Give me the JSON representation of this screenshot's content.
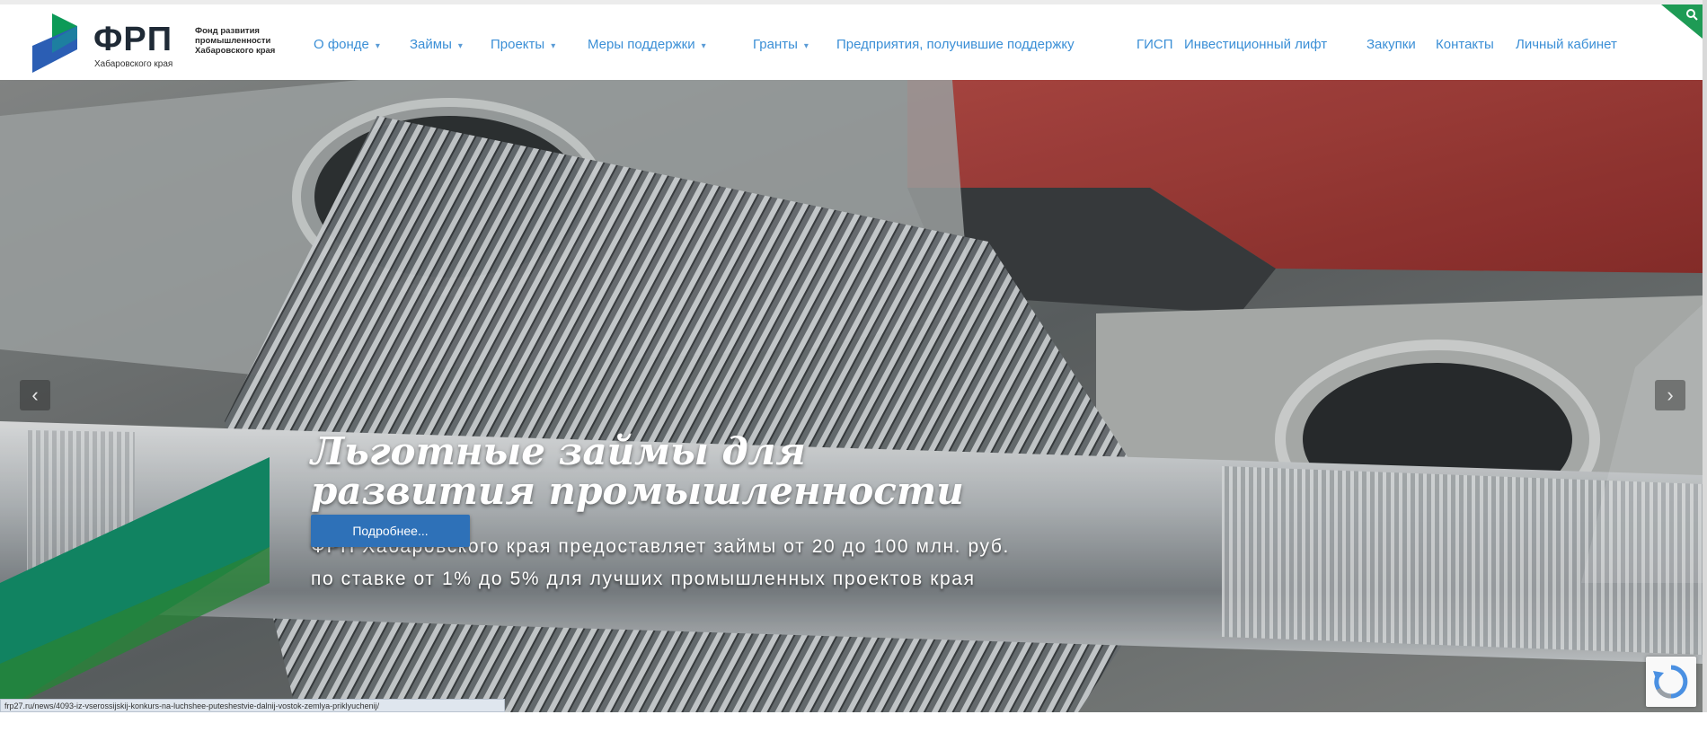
{
  "logo": {
    "abbr": "ФРП",
    "subtitle_lines": [
      "Фонд развития",
      "промышленности",
      "Хабаровского края"
    ],
    "city": "Хабаровского края",
    "colors": {
      "dark": "#1f2a36",
      "green": "#0c9a57",
      "blue": "#2b5eb4"
    }
  },
  "nav": {
    "items": [
      {
        "label": "О фонде",
        "caret": "▾"
      },
      {
        "label": "Займы",
        "caret": "▾"
      },
      {
        "label": "Проекты",
        "caret": "▾"
      },
      {
        "label": "Меры поддержки",
        "caret": "▾"
      },
      {
        "label": "Гранты",
        "caret": "▾"
      },
      {
        "label": "Предприятия, получившие поддержку"
      },
      {
        "label": "ГИСП"
      },
      {
        "label": "Инвестиционный лифт"
      },
      {
        "label": "Закупки"
      },
      {
        "label": "Контакты"
      },
      {
        "label": "Личный кабинет"
      }
    ],
    "link_color": "#3b8fd6"
  },
  "hero": {
    "title": "Льготные займы для развития промышленности",
    "description_line1": "ФРП Хабаровского края предоставляет займы от 20 до 100 млн. руб.",
    "description_line2": "по ставке от 1% до 5% для лучших промышленных проектов края",
    "button_label": "Подробнее...",
    "button_color": "#2e71b8",
    "accent_green": "#138f6a",
    "prev_arrow": "‹",
    "next_arrow": "›"
  },
  "status_bar": {
    "url": "frp27.ru/news/4093-iz-vserossijskij-konkurs-na-luchshee-puteshestvie-dalnij-vostok-zemlya-priklyuchenij/"
  },
  "icons": {
    "corner": "search-icon",
    "recaptcha": "recaptcha-icon"
  }
}
